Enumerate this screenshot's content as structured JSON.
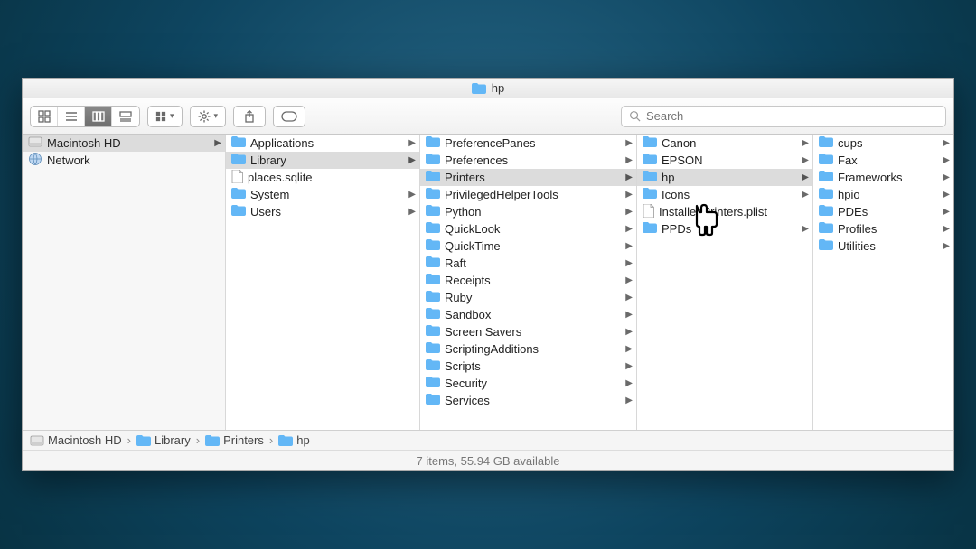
{
  "window": {
    "title": "hp"
  },
  "toolbar": {
    "search_placeholder": "Search",
    "view_buttons": [
      "icon",
      "list",
      "column",
      "coverflow"
    ],
    "active_view": "column"
  },
  "columns": [
    {
      "id": "devices",
      "items": [
        {
          "label": "Macintosh HD",
          "icon": "disk",
          "children": true,
          "in_path": true
        },
        {
          "label": "Network",
          "icon": "network",
          "children": false
        }
      ]
    },
    {
      "id": "root",
      "items": [
        {
          "label": "Applications",
          "icon": "folder",
          "children": true
        },
        {
          "label": "Library",
          "icon": "folder-special",
          "children": true,
          "in_path": true
        },
        {
          "label": "places.sqlite",
          "icon": "file",
          "children": false
        },
        {
          "label": "System",
          "icon": "folder-x",
          "children": true
        },
        {
          "label": "Users",
          "icon": "folder",
          "children": true
        }
      ]
    },
    {
      "id": "library",
      "items": [
        {
          "label": "PreferencePanes",
          "icon": "folder",
          "children": true
        },
        {
          "label": "Preferences",
          "icon": "folder",
          "children": true
        },
        {
          "label": "Printers",
          "icon": "folder",
          "children": true,
          "in_path": true
        },
        {
          "label": "PrivilegedHelperTools",
          "icon": "folder",
          "children": true
        },
        {
          "label": "Python",
          "icon": "folder",
          "children": true
        },
        {
          "label": "QuickLook",
          "icon": "folder",
          "children": true
        },
        {
          "label": "QuickTime",
          "icon": "folder",
          "children": true
        },
        {
          "label": "Raft",
          "icon": "folder",
          "children": true
        },
        {
          "label": "Receipts",
          "icon": "folder",
          "children": true
        },
        {
          "label": "Ruby",
          "icon": "folder",
          "children": true
        },
        {
          "label": "Sandbox",
          "icon": "folder",
          "children": true
        },
        {
          "label": "Screen Savers",
          "icon": "folder",
          "children": true
        },
        {
          "label": "ScriptingAdditions",
          "icon": "folder",
          "children": true
        },
        {
          "label": "Scripts",
          "icon": "folder",
          "children": true
        },
        {
          "label": "Security",
          "icon": "folder",
          "children": true
        },
        {
          "label": "Services",
          "icon": "folder",
          "children": true
        }
      ]
    },
    {
      "id": "printers",
      "items": [
        {
          "label": "Canon",
          "icon": "folder",
          "children": true
        },
        {
          "label": "EPSON",
          "icon": "folder",
          "children": true
        },
        {
          "label": "hp",
          "icon": "folder",
          "children": true,
          "in_path": true
        },
        {
          "label": "Icons",
          "icon": "folder",
          "children": true
        },
        {
          "label": "InstalledPrinters.plist",
          "icon": "file",
          "children": false
        },
        {
          "label": "PPDs",
          "icon": "folder",
          "children": true
        }
      ]
    },
    {
      "id": "hp",
      "items": [
        {
          "label": "cups",
          "icon": "folder",
          "children": true
        },
        {
          "label": "Fax",
          "icon": "folder",
          "children": true
        },
        {
          "label": "Frameworks",
          "icon": "folder",
          "children": true
        },
        {
          "label": "hpio",
          "icon": "folder",
          "children": true
        },
        {
          "label": "PDEs",
          "icon": "folder",
          "children": true
        },
        {
          "label": "Profiles",
          "icon": "folder",
          "children": true
        },
        {
          "label": "Utilities",
          "icon": "folder",
          "children": true
        }
      ]
    }
  ],
  "pathbar": [
    {
      "label": "Macintosh HD",
      "icon": "disk"
    },
    {
      "label": "Library",
      "icon": "folder"
    },
    {
      "label": "Printers",
      "icon": "folder"
    },
    {
      "label": "hp",
      "icon": "folder"
    }
  ],
  "status": {
    "text": "7 items, 55.94 GB available"
  }
}
